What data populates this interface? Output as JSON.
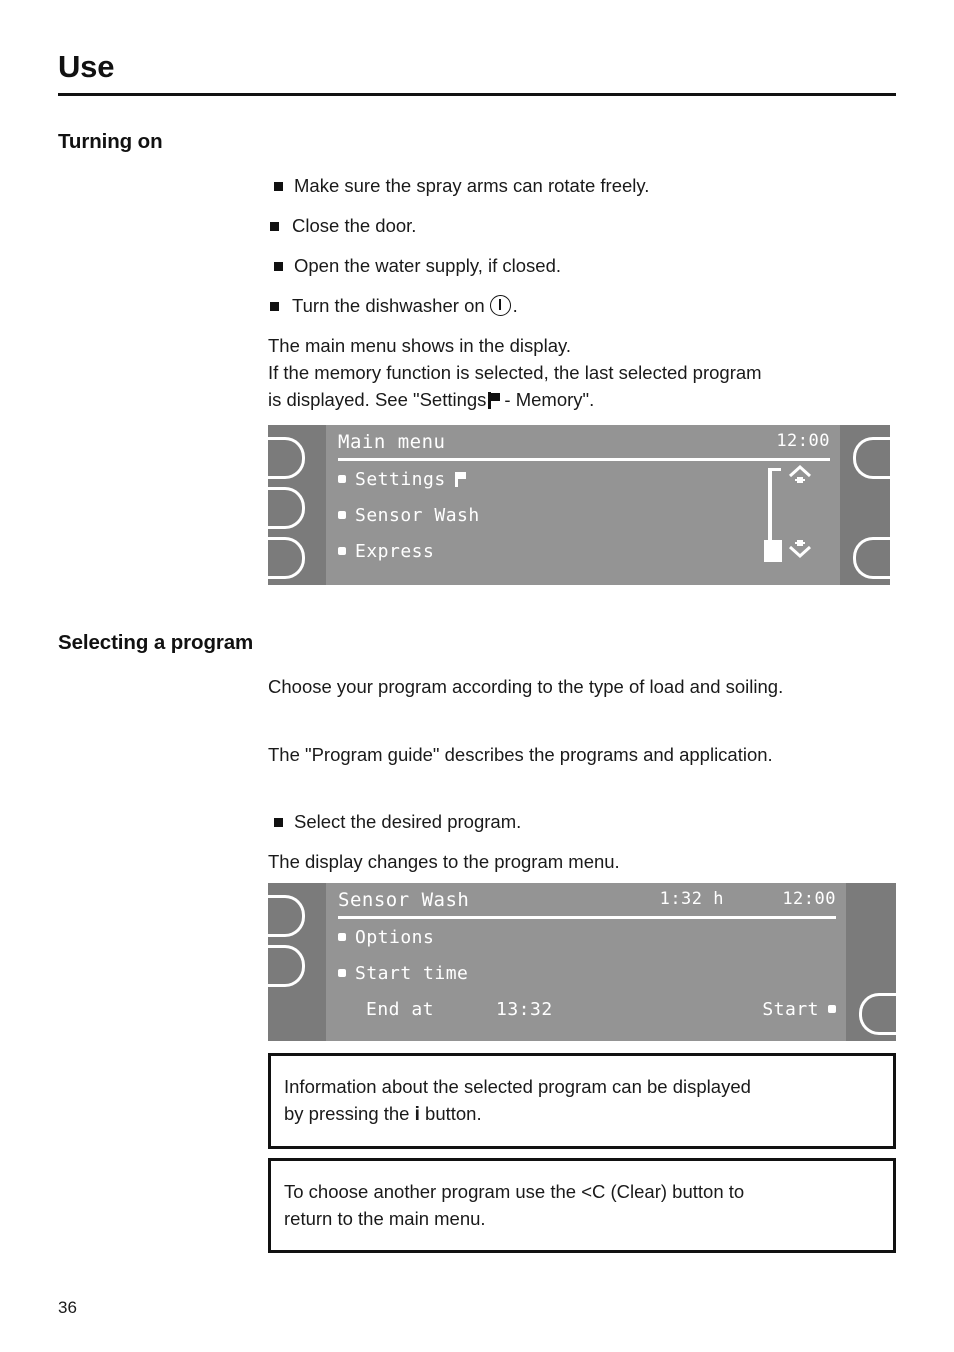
{
  "header": {
    "title": "Use"
  },
  "sections": {
    "turning_on": {
      "heading": "Turning on",
      "bullets": [
        "Make sure the spray arms can rotate freely.",
        "Close the door.",
        "Open the water supply, if closed.",
        "Turn the dishwasher on"
      ],
      "bullet4_suffix": ".",
      "paragraph_lines": [
        "The main menu shows in the display.",
        "If the memory function is selected, the last selected program",
        "is displayed. See \"Settings"
      ],
      "paragraph_tail": "- Memory\"."
    },
    "selecting_program": {
      "heading": "Selecting a program",
      "paragraph1": "Choose your program according to the type of load and soiling.",
      "paragraph2": "The \"Program guide\" describes the programs and application.",
      "bullet": "Select the desired program.",
      "paragraph3": "The display changes to the program menu."
    }
  },
  "display_main_menu": {
    "title": "Main menu",
    "clock": "12:00",
    "items": [
      {
        "label": "Settings",
        "icon": "flag-icon"
      },
      {
        "label": "Sensor Wash",
        "icon": ""
      },
      {
        "label": "Express",
        "icon": ""
      }
    ],
    "scroll_up_icon": "chevron-up-icon",
    "scroll_down_icon": "chevron-down-icon"
  },
  "display_program_menu": {
    "title": "Sensor Wash",
    "duration": "1:32 h",
    "clock": "12:00",
    "items": [
      {
        "label": "Options"
      },
      {
        "label": "Start time"
      }
    ],
    "end_at_label": "End at",
    "end_at_value": "13:32",
    "start_label": "Start"
  },
  "notes": [
    {
      "line1": "Information about the selected program can be displayed",
      "line2_before": "by pressing the",
      "line2_glyph": "i",
      "line2_after": "button."
    },
    {
      "line1": "To choose another program use the <C (Clear) button to",
      "line2": "return to the main menu."
    }
  ],
  "footer": {
    "page_number": "36"
  },
  "colors": {
    "lcd_screen": "#949494",
    "lcd_bezel": "#7b7b7b",
    "lcd_text": "#ffffff",
    "rule": "#111111"
  }
}
